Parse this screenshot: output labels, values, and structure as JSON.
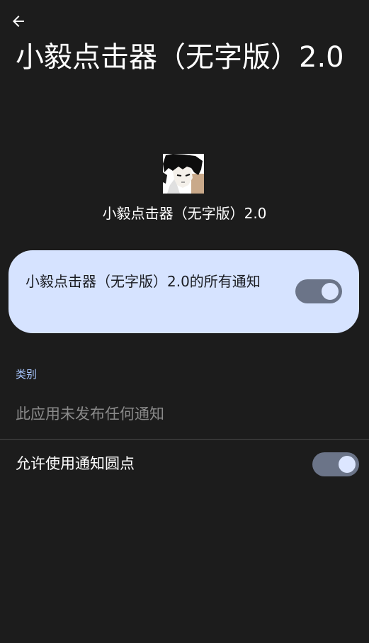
{
  "header": {
    "back_icon": "arrow-back-icon",
    "title": "小毅点击器（无字版）2.0"
  },
  "app": {
    "name": "小毅点击器（无字版）2.0",
    "icon": "app-icon-anime-avatar"
  },
  "all_notifications": {
    "label": "小毅点击器（无字版）2.0的所有通知",
    "enabled": true
  },
  "categories": {
    "header": "类别",
    "empty_text": "此应用未发布任何通知"
  },
  "notification_dots": {
    "label": "允许使用通知圆点",
    "enabled": true
  },
  "colors": {
    "background": "#1c1c1c",
    "card": "#d6e3ff",
    "switch_track": "#6b7488",
    "switch_thumb": "#dce6ff",
    "section_header": "#a9c7ff"
  }
}
